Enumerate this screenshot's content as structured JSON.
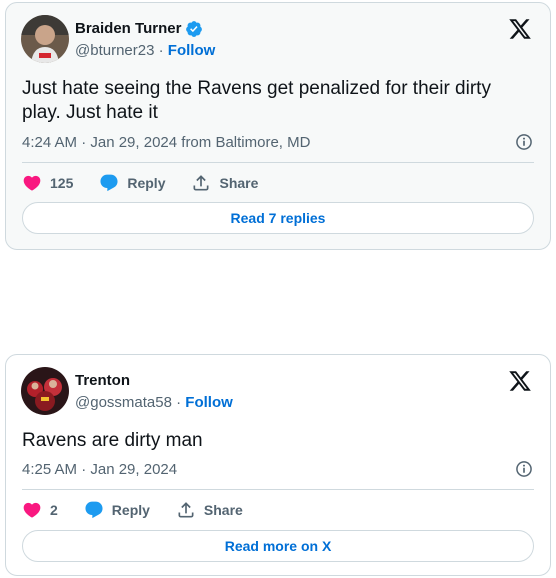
{
  "tweets": [
    {
      "display_name": "Braiden Turner",
      "verified": true,
      "handle": "@bturner23",
      "separator": " · ",
      "follow_label": "Follow",
      "text": "Just hate seeing the Ravens get penalized for their dirty play. Just hate it",
      "timestamp": "4:24 AM · Jan 29, 2024 from Baltimore, MD",
      "likes": "125",
      "reply_label": "Reply",
      "share_label": "Share",
      "cta_label": "Read 7 replies"
    },
    {
      "display_name": "Trenton",
      "verified": false,
      "handle": "@gossmata58",
      "separator": " · ",
      "follow_label": "Follow",
      "text": "Ravens are dirty man",
      "timestamp": "4:25 AM · Jan 29, 2024",
      "likes": "2",
      "reply_label": "Reply",
      "share_label": "Share",
      "cta_label": "Read more on X"
    }
  ],
  "colors": {
    "link_blue": "#006fd6",
    "like_pink": "#f91880",
    "reply_blue": "#1d9bf0",
    "text_secondary": "#536471",
    "border": "#cfd9de"
  },
  "icons": [
    "verified-badge-icon",
    "x-logo-icon",
    "info-icon",
    "heart-icon",
    "reply-bubble-icon",
    "share-icon"
  ]
}
